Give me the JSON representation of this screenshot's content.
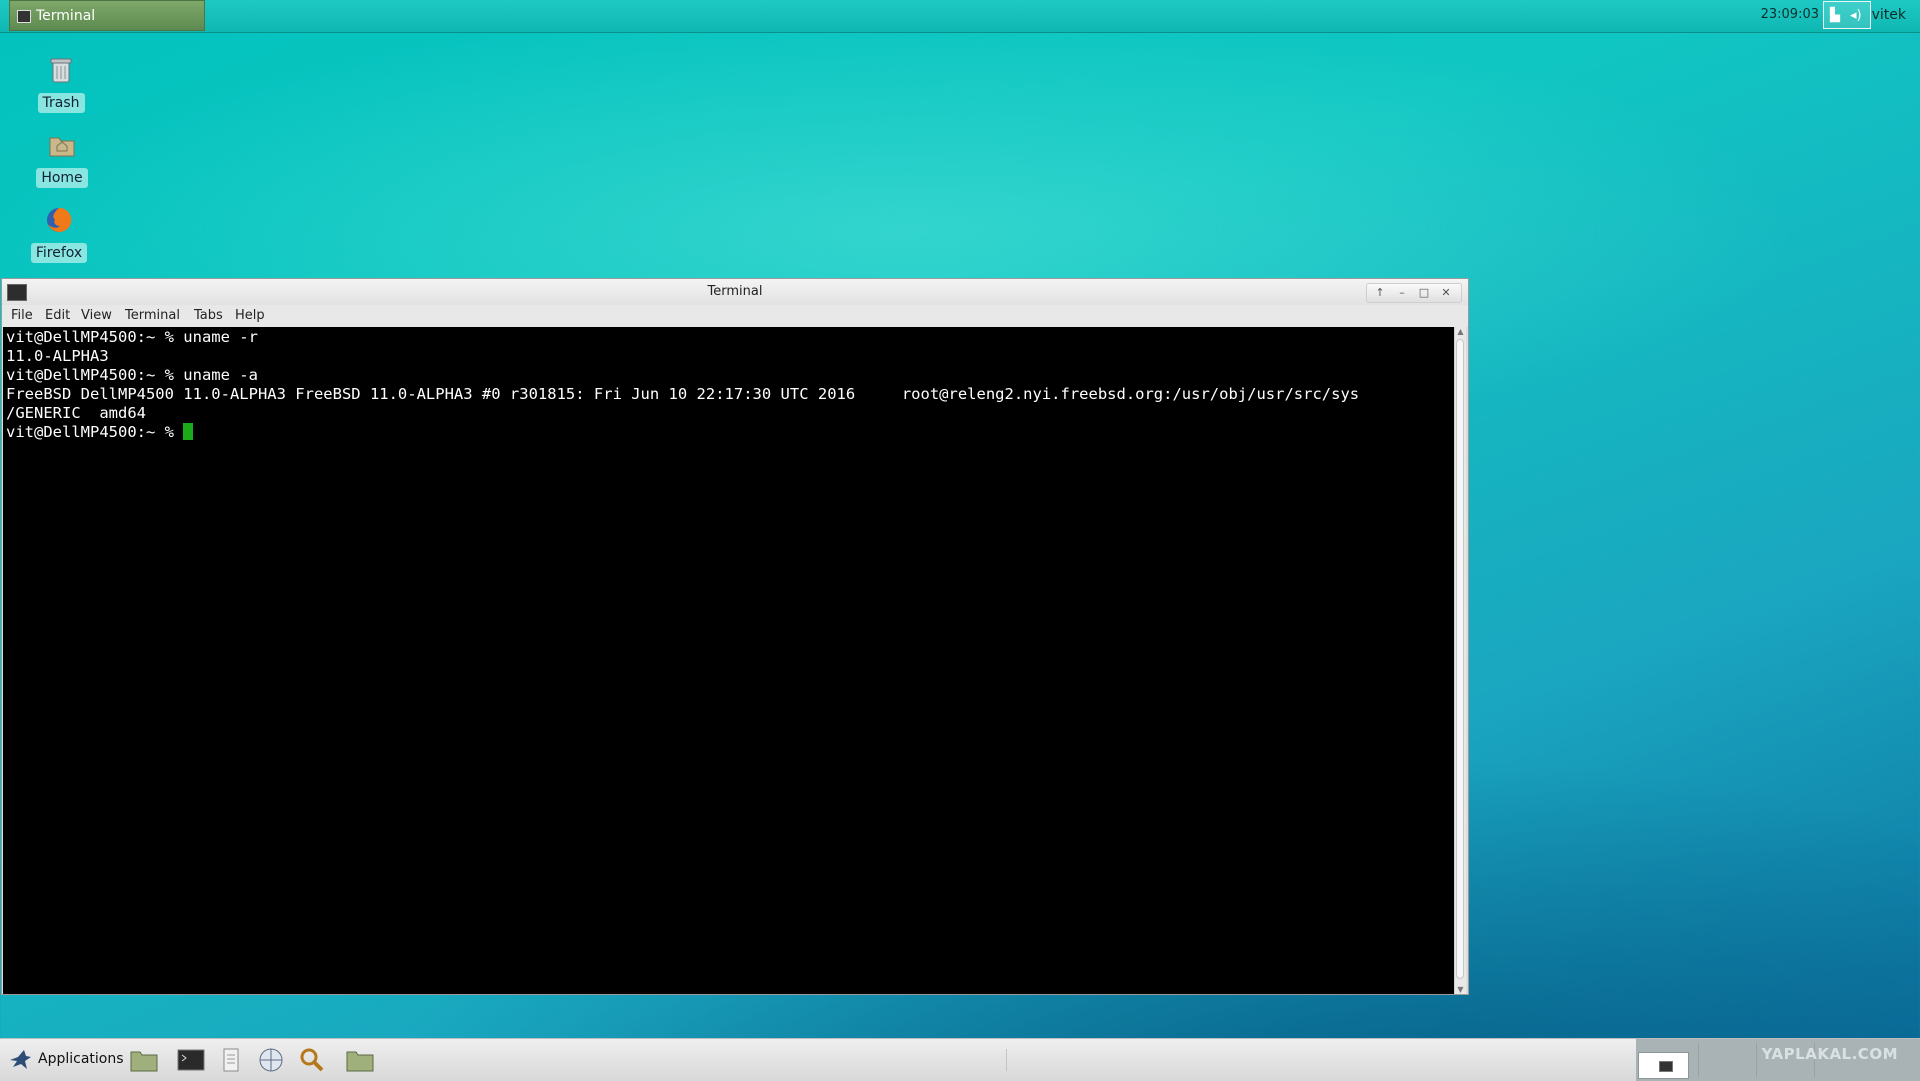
{
  "top_panel": {
    "task_title": "Terminal",
    "clock": "23:09:03",
    "user": "vitek"
  },
  "desktop": {
    "icons": [
      {
        "label": "Trash",
        "icon": "trash-icon"
      },
      {
        "label": "Home",
        "icon": "home-folder-icon"
      },
      {
        "label": "Firefox",
        "icon": "firefox-icon"
      }
    ]
  },
  "window": {
    "title": "Terminal",
    "menu": [
      "File",
      "Edit",
      "View",
      "Terminal",
      "Tabs",
      "Help"
    ],
    "lines": [
      "vit@DellMP4500:~ % uname -r",
      "11.0-ALPHA3",
      "vit@DellMP4500:~ % uname -a",
      "FreeBSD DellMP4500 11.0-ALPHA3 FreeBSD 11.0-ALPHA3 #0 r301815: Fri Jun 10 22:17:30 UTC 2016     root@releng2.nyi.freebsd.org:/usr/obj/usr/src/sys",
      "/GENERIC  amd64"
    ],
    "prompt": "vit@DellMP4500:~ % "
  },
  "bottom_panel": {
    "applications_label": "Applications",
    "launchers": [
      "file-manager-icon",
      "terminal-icon",
      "text-editor-icon",
      "web-browser-icon",
      "search-icon",
      "folder-icon"
    ],
    "watermark": "YAPLAKAL.COM"
  },
  "colors": {
    "desktop": "#0fbfba",
    "cursor": "#1aaa1a",
    "terminal_bg": "#000000"
  }
}
